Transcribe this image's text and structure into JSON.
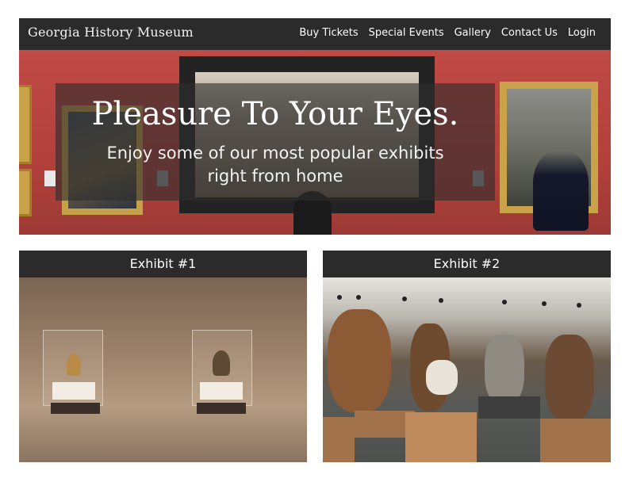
{
  "header": {
    "brand": "Georgia History Museum",
    "nav": [
      "Buy Tickets",
      "Special Events",
      "Gallery",
      "Contact Us",
      "Login"
    ]
  },
  "hero": {
    "title": "Pleasure To Your Eyes.",
    "subtitle_line1": "Enjoy some of our most popular exhibits",
    "subtitle_line2": "right from home"
  },
  "exhibits": [
    {
      "title": "Exhibit #1"
    },
    {
      "title": "Exhibit #2"
    }
  ]
}
